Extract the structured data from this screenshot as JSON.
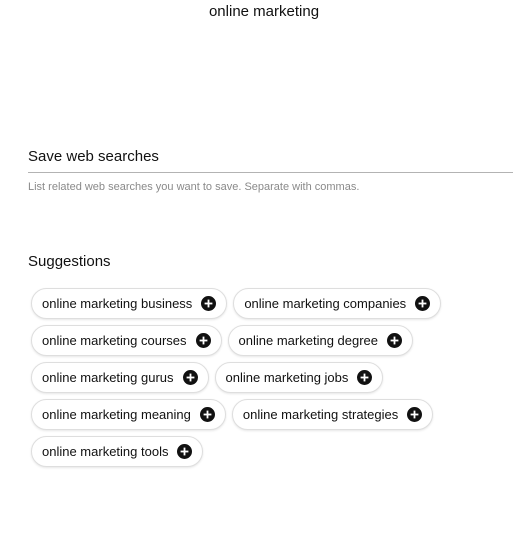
{
  "header": {
    "title": "online marketing"
  },
  "save_searches": {
    "placeholder": "Save web searches",
    "helper": "List related web searches you want to save. Separate with commas."
  },
  "suggestions": {
    "title": "Suggestions",
    "items": [
      {
        "label": "online marketing business"
      },
      {
        "label": "online marketing companies"
      },
      {
        "label": "online marketing courses"
      },
      {
        "label": "online marketing degree"
      },
      {
        "label": "online marketing gurus"
      },
      {
        "label": "online marketing jobs"
      },
      {
        "label": "online marketing meaning"
      },
      {
        "label": "online marketing strategies"
      },
      {
        "label": "online marketing tools"
      }
    ],
    "add_icon": "plus-circle-icon"
  },
  "colors": {
    "text": "#111111",
    "helper_text": "#8a8a8a",
    "chip_border": "#dedede",
    "icon_fill": "#111111"
  }
}
